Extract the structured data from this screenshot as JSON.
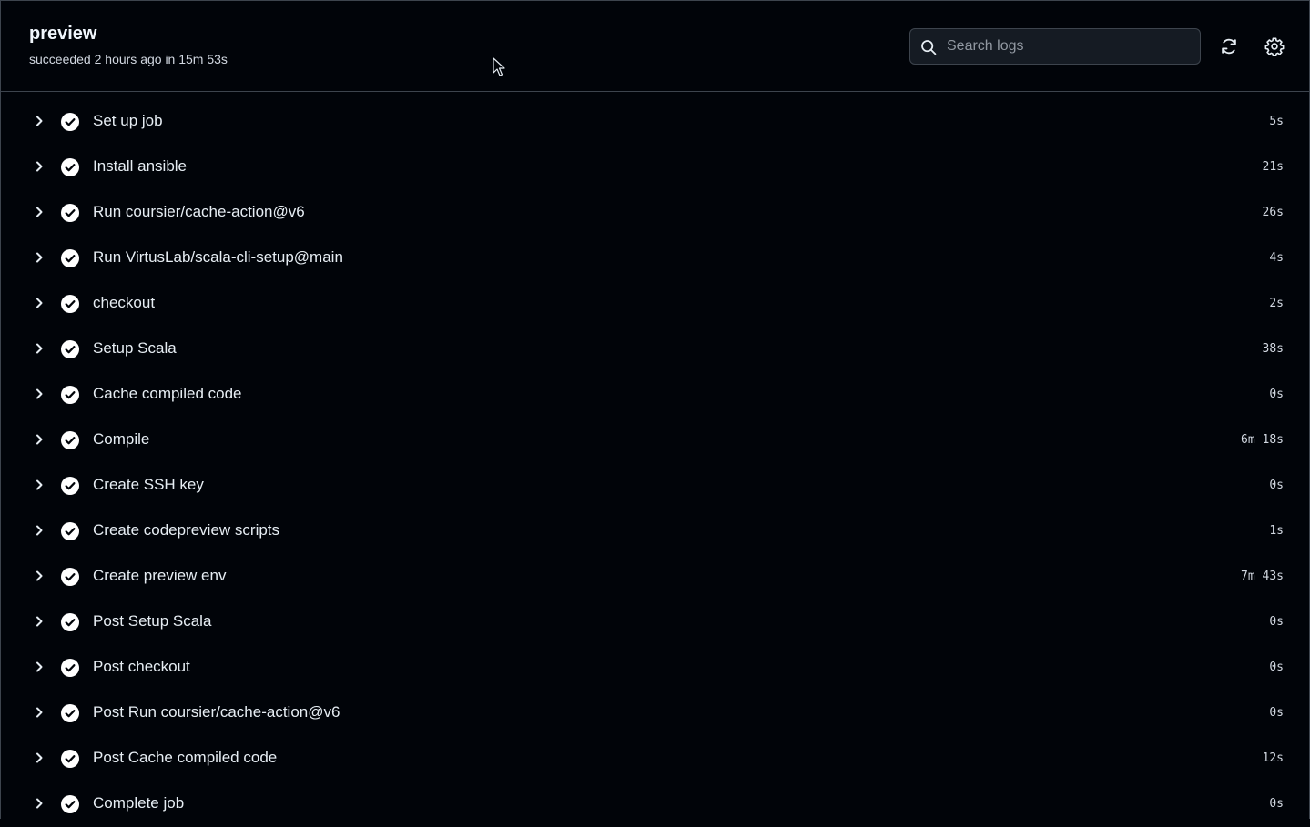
{
  "header": {
    "title": "preview",
    "status": "succeeded 2 hours ago in 15m 53s",
    "search_placeholder": "Search logs",
    "search_value": "",
    "refresh_icon": "refresh-icon",
    "settings_icon": "gear-icon"
  },
  "colors": {
    "background": "#010409",
    "border": "#3d444d",
    "success_icon_bg": "#ffffff",
    "text": "#e6edf3"
  },
  "steps": [
    {
      "name": "Set up job",
      "duration": "5s",
      "status": "success"
    },
    {
      "name": "Install ansible",
      "duration": "21s",
      "status": "success"
    },
    {
      "name": "Run coursier/cache-action@v6",
      "duration": "26s",
      "status": "success"
    },
    {
      "name": "Run VirtusLab/scala-cli-setup@main",
      "duration": "4s",
      "status": "success"
    },
    {
      "name": "checkout",
      "duration": "2s",
      "status": "success"
    },
    {
      "name": "Setup Scala",
      "duration": "38s",
      "status": "success"
    },
    {
      "name": "Cache compiled code",
      "duration": "0s",
      "status": "success"
    },
    {
      "name": "Compile",
      "duration": "6m 18s",
      "status": "success"
    },
    {
      "name": "Create SSH key",
      "duration": "0s",
      "status": "success"
    },
    {
      "name": "Create codepreview scripts",
      "duration": "1s",
      "status": "success"
    },
    {
      "name": "Create preview env",
      "duration": "7m 43s",
      "status": "success"
    },
    {
      "name": "Post Setup Scala",
      "duration": "0s",
      "status": "success"
    },
    {
      "name": "Post checkout",
      "duration": "0s",
      "status": "success"
    },
    {
      "name": "Post Run coursier/cache-action@v6",
      "duration": "0s",
      "status": "success"
    },
    {
      "name": "Post Cache compiled code",
      "duration": "12s",
      "status": "success"
    },
    {
      "name": "Complete job",
      "duration": "0s",
      "status": "success"
    }
  ]
}
